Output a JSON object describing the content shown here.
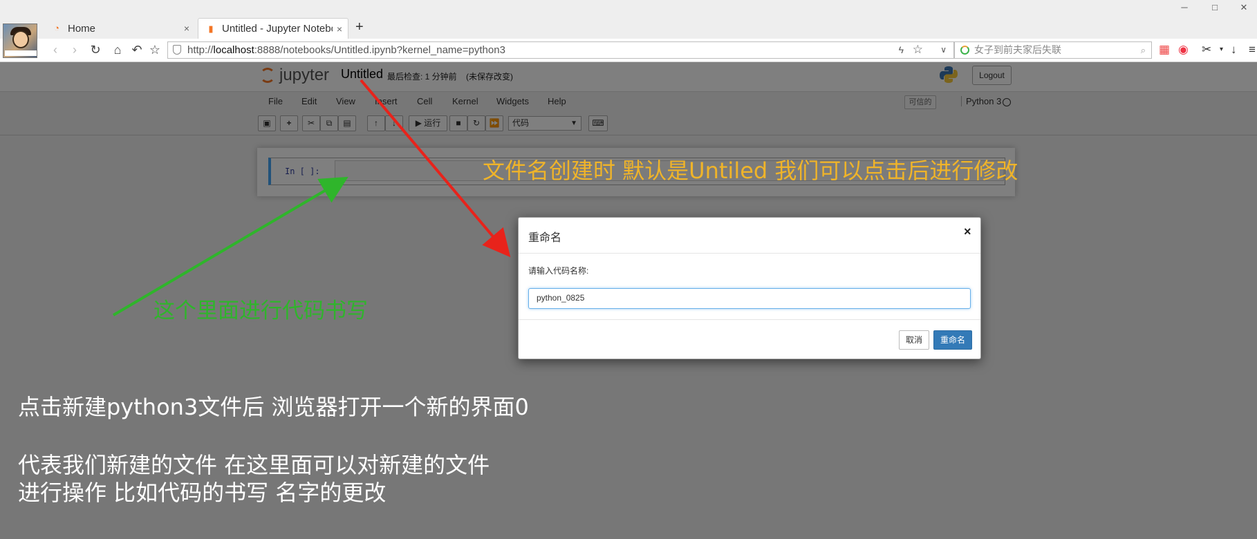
{
  "browser": {
    "window_controls": {
      "minimize": "─",
      "maximize": "□",
      "close": "✕"
    },
    "tabs": [
      {
        "label": "Home",
        "close": "×"
      },
      {
        "label": "Untitled - Jupyter Notebook",
        "close": "×"
      }
    ],
    "new_tab": "+",
    "url_prefix": "http://",
    "url_host": "localhost",
    "url_rest": ":8888/notebooks/Untitled.ipynb?kernel_name=python3",
    "search_placeholder": "女子到前夫家后失联"
  },
  "jupyter": {
    "logo_text": "jupyter",
    "notebook_name": "Untitled",
    "checkpoint": "最后检查: 1 分钟前",
    "unsaved": "(未保存改变)",
    "logout": "Logout",
    "menu": [
      "File",
      "Edit",
      "View",
      "Insert",
      "Cell",
      "Kernel",
      "Widgets",
      "Help"
    ],
    "trusted": "可信的",
    "kernel": "Python 3",
    "toolbar": {
      "run": "▶ 运行",
      "cell_type": "代码"
    },
    "cell_prompt": "In [ ]:"
  },
  "dialog": {
    "title": "重命名",
    "close": "×",
    "prompt": "请输入代码名称:",
    "input_value": "python_0825",
    "cancel": "取消",
    "confirm": "重命名"
  },
  "annotations": {
    "filename_note": "文件名创建时 默认是Untiled  我们可以点击后进行修改",
    "code_note": "这个里面进行代码书写",
    "new_file_line1": "点击新建python3文件后 浏览器打开一个新的界面0",
    "new_file_line2": "代表我们新建的文件  在这里面可以对新建的文件",
    "new_file_line3": "进行操作  比如代码的书写 名字的更改",
    "colors": {
      "filename": "#f0b429",
      "code": "#2fb52b",
      "arrow_red": "#e8231b",
      "arrow_green": "#2fb52b"
    }
  }
}
